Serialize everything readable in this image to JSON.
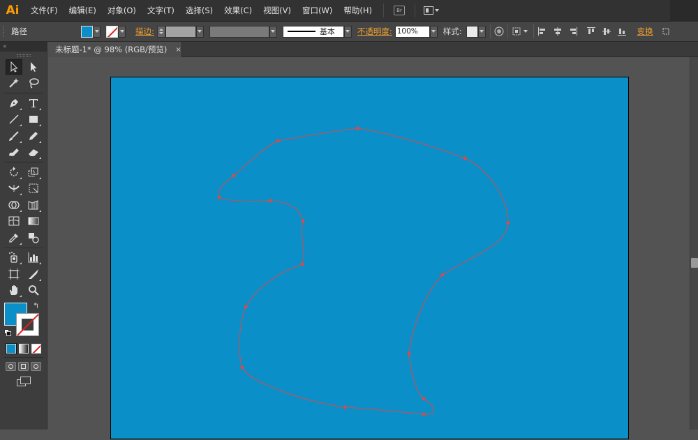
{
  "app": {
    "logo": "Ai"
  },
  "menu": {
    "items": [
      "文件(F)",
      "编辑(E)",
      "对象(O)",
      "文字(T)",
      "选择(S)",
      "效果(C)",
      "视图(V)",
      "窗口(W)",
      "帮助(H)"
    ],
    "bridge_label": "Br"
  },
  "control": {
    "selection_type": "路径",
    "stroke_label": "描边:",
    "stroke_profile": "基本",
    "opacity_label": "不透明度:",
    "opacity_value": "100%",
    "style_label": "样式:",
    "transform_label": "变换",
    "fill_color": "#0a8fc8"
  },
  "document": {
    "tab_title": "未标题-1* @ 98% (RGB/预览)",
    "close_glyph": "×"
  },
  "canvas": {
    "artboard_color": "#0a8fc8",
    "path_color": "#d94a4a"
  },
  "toolbox": {
    "collapse_glyph": "«",
    "swap_glyph": "↰"
  }
}
